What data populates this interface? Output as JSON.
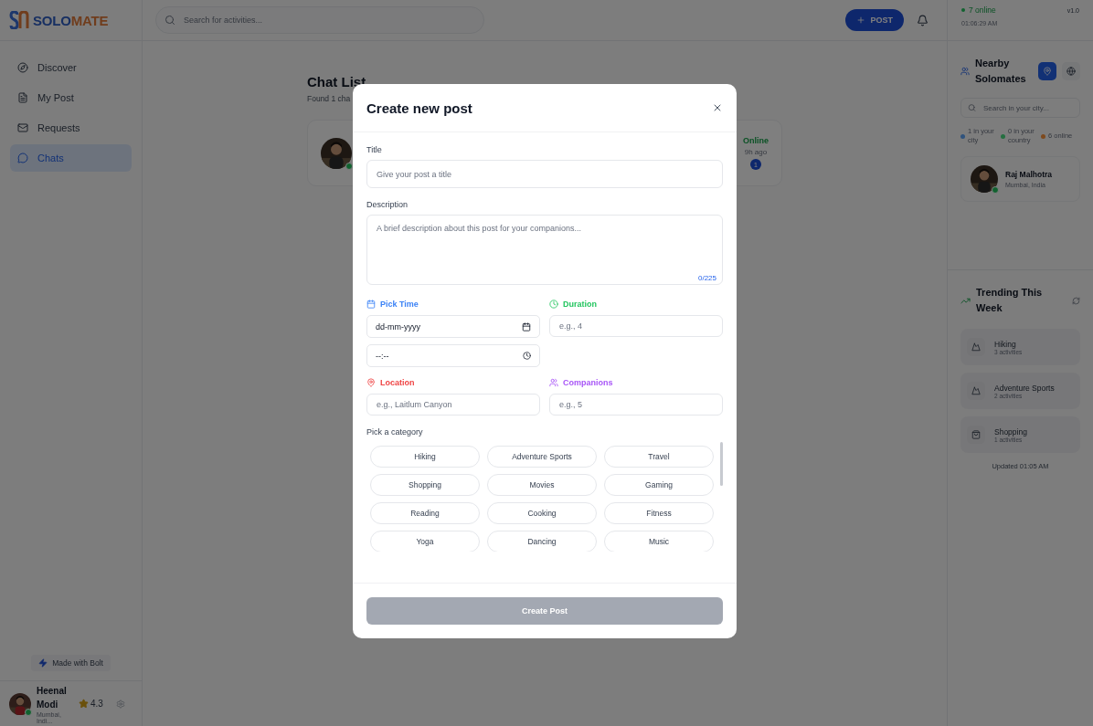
{
  "brand": {
    "name_first": "SOLO",
    "name_second": "MATE"
  },
  "header": {
    "search_placeholder": "Search for activities...",
    "post_button": "POST"
  },
  "status": {
    "online": "7 online",
    "version": "v1.0",
    "clock": "01:06:29 AM"
  },
  "sidebar": {
    "items": [
      {
        "label": "Discover",
        "selected": false
      },
      {
        "label": "My Post",
        "selected": false
      },
      {
        "label": "Requests",
        "selected": false
      },
      {
        "label": "Chats",
        "selected": true
      }
    ],
    "made_with": "Made with Bolt",
    "user": {
      "name": "Heenal Modi",
      "rating": "4.3",
      "location": "Mumbai, Indi...",
      "online": true
    }
  },
  "main": {
    "title": "Chat List",
    "subtitle": "Found 1 cha",
    "chats": [
      {
        "status": "Online",
        "time": "9h ago",
        "unread": "1",
        "online": true
      }
    ]
  },
  "nearby": {
    "title": "Nearby Solomates",
    "views": [
      {
        "selected": true
      },
      {
        "selected": false
      }
    ],
    "search_placeholder": "Search in your city...",
    "stats": [
      {
        "label": "1 in your city",
        "color": "#30537d"
      },
      {
        "label": "0 in your country",
        "color": "#256f40"
      },
      {
        "label": "6 online",
        "color": "#7e4a1e"
      }
    ],
    "people": [
      {
        "name": "Raj Malhotra",
        "location": "Mumbai, India",
        "online": true
      }
    ]
  },
  "trending": {
    "title": "Trending This Week",
    "items": [
      {
        "name": "Hiking",
        "count": "3 activities"
      },
      {
        "name": "Adventure Sports",
        "count": "2 activities"
      },
      {
        "name": "Shopping",
        "count": "1 activities"
      }
    ],
    "updated": "Updated 01:05 AM"
  },
  "modal": {
    "title": "Create new post",
    "title_label": "Title",
    "title_placeholder": "Give your post a title",
    "description_label": "Description",
    "description_placeholder": "A brief description about this post for your companions...",
    "counter": "0/225",
    "time_label": "Pick Time",
    "date_value": "dd-mm-yyyy",
    "time_value": "--:--",
    "duration_label": "Duration",
    "duration_placeholder": "e.g., 4",
    "location_label": "Location",
    "location_placeholder": "e.g., Laitlum Canyon",
    "companions_label": "Companions",
    "companions_placeholder": "e.g., 5",
    "category_label": "Pick a category",
    "categories": [
      {
        "label": "Hiking",
        "selected": false
      },
      {
        "label": "Adventure Sports",
        "selected": false
      },
      {
        "label": "Travel",
        "selected": false
      },
      {
        "label": "Shopping",
        "selected": false
      },
      {
        "label": "Movies",
        "selected": false
      },
      {
        "label": "Gaming",
        "selected": false
      },
      {
        "label": "Reading",
        "selected": false
      },
      {
        "label": "Cooking",
        "selected": false
      },
      {
        "label": "Fitness",
        "selected": false
      },
      {
        "label": "Yoga",
        "selected": false
      },
      {
        "label": "Dancing",
        "selected": false
      },
      {
        "label": "Music",
        "selected": false
      }
    ],
    "submit": {
      "label": "Create Post",
      "disabled": true
    }
  }
}
